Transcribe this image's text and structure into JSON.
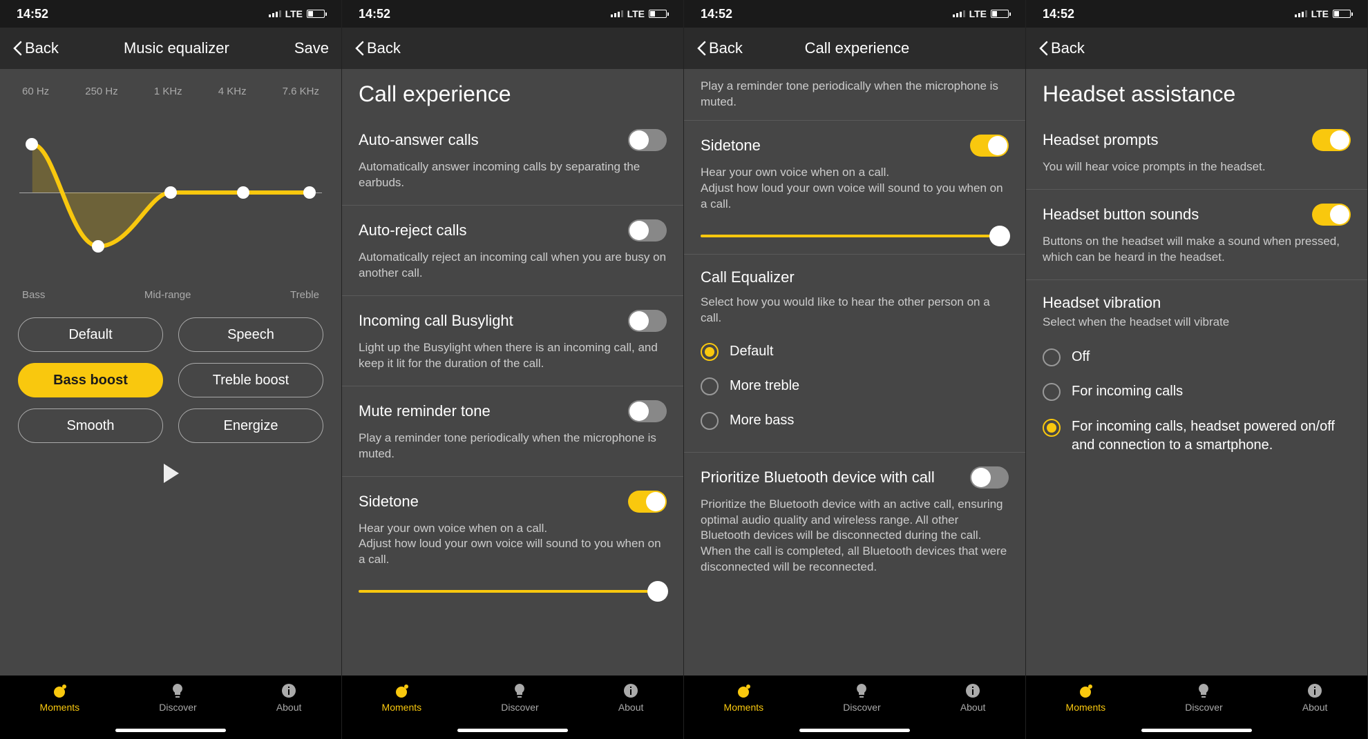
{
  "status": {
    "time": "14:52",
    "network": "LTE"
  },
  "nav": {
    "back": "Back",
    "save": "Save"
  },
  "tabbar": {
    "moments": "Moments",
    "discover": "Discover",
    "about": "About"
  },
  "screen1": {
    "title": "Music equalizer",
    "freqs": [
      "60 Hz",
      "250 Hz",
      "1 KHz",
      "4 KHz",
      "7.6 KHz"
    ],
    "axes": [
      "Bass",
      "Mid-range",
      "Treble"
    ],
    "presets": [
      "Default",
      "Speech",
      "Bass boost",
      "Treble boost",
      "Smooth",
      "Energize"
    ],
    "active_preset": "Bass boost"
  },
  "screen2": {
    "title": "Call experience",
    "items": [
      {
        "label": "Auto-answer calls",
        "desc": "Automatically answer incoming calls by separating the earbuds.",
        "on": false
      },
      {
        "label": "Auto-reject calls",
        "desc": "Automatically reject an incoming call when you are busy on another call.",
        "on": false
      },
      {
        "label": "Incoming call Busylight",
        "desc": "Light up the Busylight when there is an incoming call, and keep it lit for the duration of the call.",
        "on": false
      },
      {
        "label": "Mute reminder tone",
        "desc": "Play a reminder tone periodically when the microphone is muted.",
        "on": false
      },
      {
        "label": "Sidetone",
        "desc": "Hear your own voice when on a call.\nAdjust how loud your own voice will sound to you when on a call.",
        "on": true
      }
    ]
  },
  "screen3": {
    "title": "Call experience",
    "mute_desc": "Play a reminder tone periodically when the microphone is muted.",
    "sidetone": {
      "label": "Sidetone",
      "desc": "Hear your own voice when on a call.\nAdjust how loud your own voice will sound to you when on a call.",
      "on": true
    },
    "eq": {
      "label": "Call Equalizer",
      "desc": "Select how you would like to hear the other person on a call.",
      "options": [
        "Default",
        "More treble",
        "More bass"
      ],
      "selected": "Default"
    },
    "priority": {
      "label": "Prioritize Bluetooth device with call",
      "desc": "Prioritize the Bluetooth device with an active call, ensuring optimal audio quality and wireless range. All other Bluetooth devices will be disconnected during the call. When the call is completed, all Bluetooth devices that were disconnected will be reconnected.",
      "on": false
    }
  },
  "screen4": {
    "title": "Headset assistance",
    "prompts": {
      "label": "Headset prompts",
      "desc": "You will hear voice prompts in the headset.",
      "on": true
    },
    "sounds": {
      "label": "Headset button sounds",
      "desc": "Buttons on the headset will make a sound when pressed, which can be heard in the headset.",
      "on": true
    },
    "vibration": {
      "label": "Headset vibration",
      "desc": "Select when the headset will vibrate",
      "options": [
        "Off",
        "For incoming calls",
        "For incoming calls, headset powered on/off and connection to a smartphone."
      ],
      "selected": 2
    }
  }
}
